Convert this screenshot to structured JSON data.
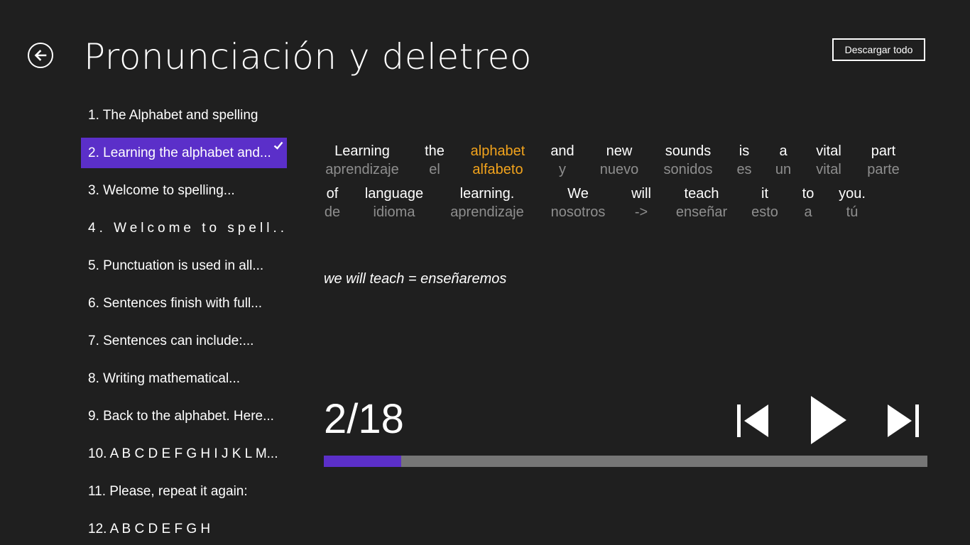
{
  "header": {
    "title": "Pronunciación y deletreo",
    "download_label": "Descargar todo"
  },
  "lessons": [
    {
      "label": "1. The Alphabet and spelling"
    },
    {
      "label": "2. Learning the alphabet and...",
      "selected": true
    },
    {
      "label": "3. Welcome to spelling..."
    },
    {
      "label": "4. Welcome to spell..."
    },
    {
      "label": "5. Punctuation is used in all..."
    },
    {
      "label": "6. Sentences finish with full..."
    },
    {
      "label": "7. Sentences can include:..."
    },
    {
      "label": "8. Writing mathematical..."
    },
    {
      "label": "9. Back to the alphabet. Here..."
    },
    {
      "label": "10. A B C D E F G H I J K L M..."
    },
    {
      "label": "11. Please, repeat it again:"
    },
    {
      "label": "12. A B C D E F G H"
    }
  ],
  "sentence": {
    "rows": [
      [
        {
          "en": "Learning",
          "es": "aprendizaje"
        },
        {
          "en": "the",
          "es": "el"
        },
        {
          "en": "alphabet",
          "es": "alfabeto",
          "highlight": true
        },
        {
          "en": "and",
          "es": "y"
        },
        {
          "en": "new",
          "es": "nuevo"
        },
        {
          "en": "sounds",
          "es": "sonidos"
        },
        {
          "en": "is",
          "es": "es"
        },
        {
          "en": "a",
          "es": "un"
        },
        {
          "en": "vital",
          "es": "vital"
        },
        {
          "en": "part",
          "es": "parte"
        }
      ],
      [
        {
          "en": "of",
          "es": "de"
        },
        {
          "en": "language",
          "es": "idioma"
        },
        {
          "en": "learning.",
          "es": "aprendizaje"
        },
        {
          "en": "We",
          "es": "nosotros"
        },
        {
          "en": "will",
          "es": "->"
        },
        {
          "en": "teach",
          "es": "enseñar"
        },
        {
          "en": "it",
          "es": "esto"
        },
        {
          "en": "to",
          "es": "a"
        },
        {
          "en": "you.",
          "es": "tú"
        }
      ]
    ],
    "note": "we will teach = enseñaremos"
  },
  "player": {
    "counter": "2/18",
    "current": 2,
    "total": 18,
    "progress_fraction": 0.128
  },
  "colors": {
    "background": "#1f1f1f",
    "accent": "#5b2fc9",
    "highlight": "#f2a31c",
    "translation": "#8e8e8e",
    "track": "#767676"
  },
  "icons": {
    "back": "back-arrow-icon",
    "check": "check-icon",
    "prev": "skip-previous-icon",
    "play": "play-icon",
    "next": "skip-next-icon"
  }
}
